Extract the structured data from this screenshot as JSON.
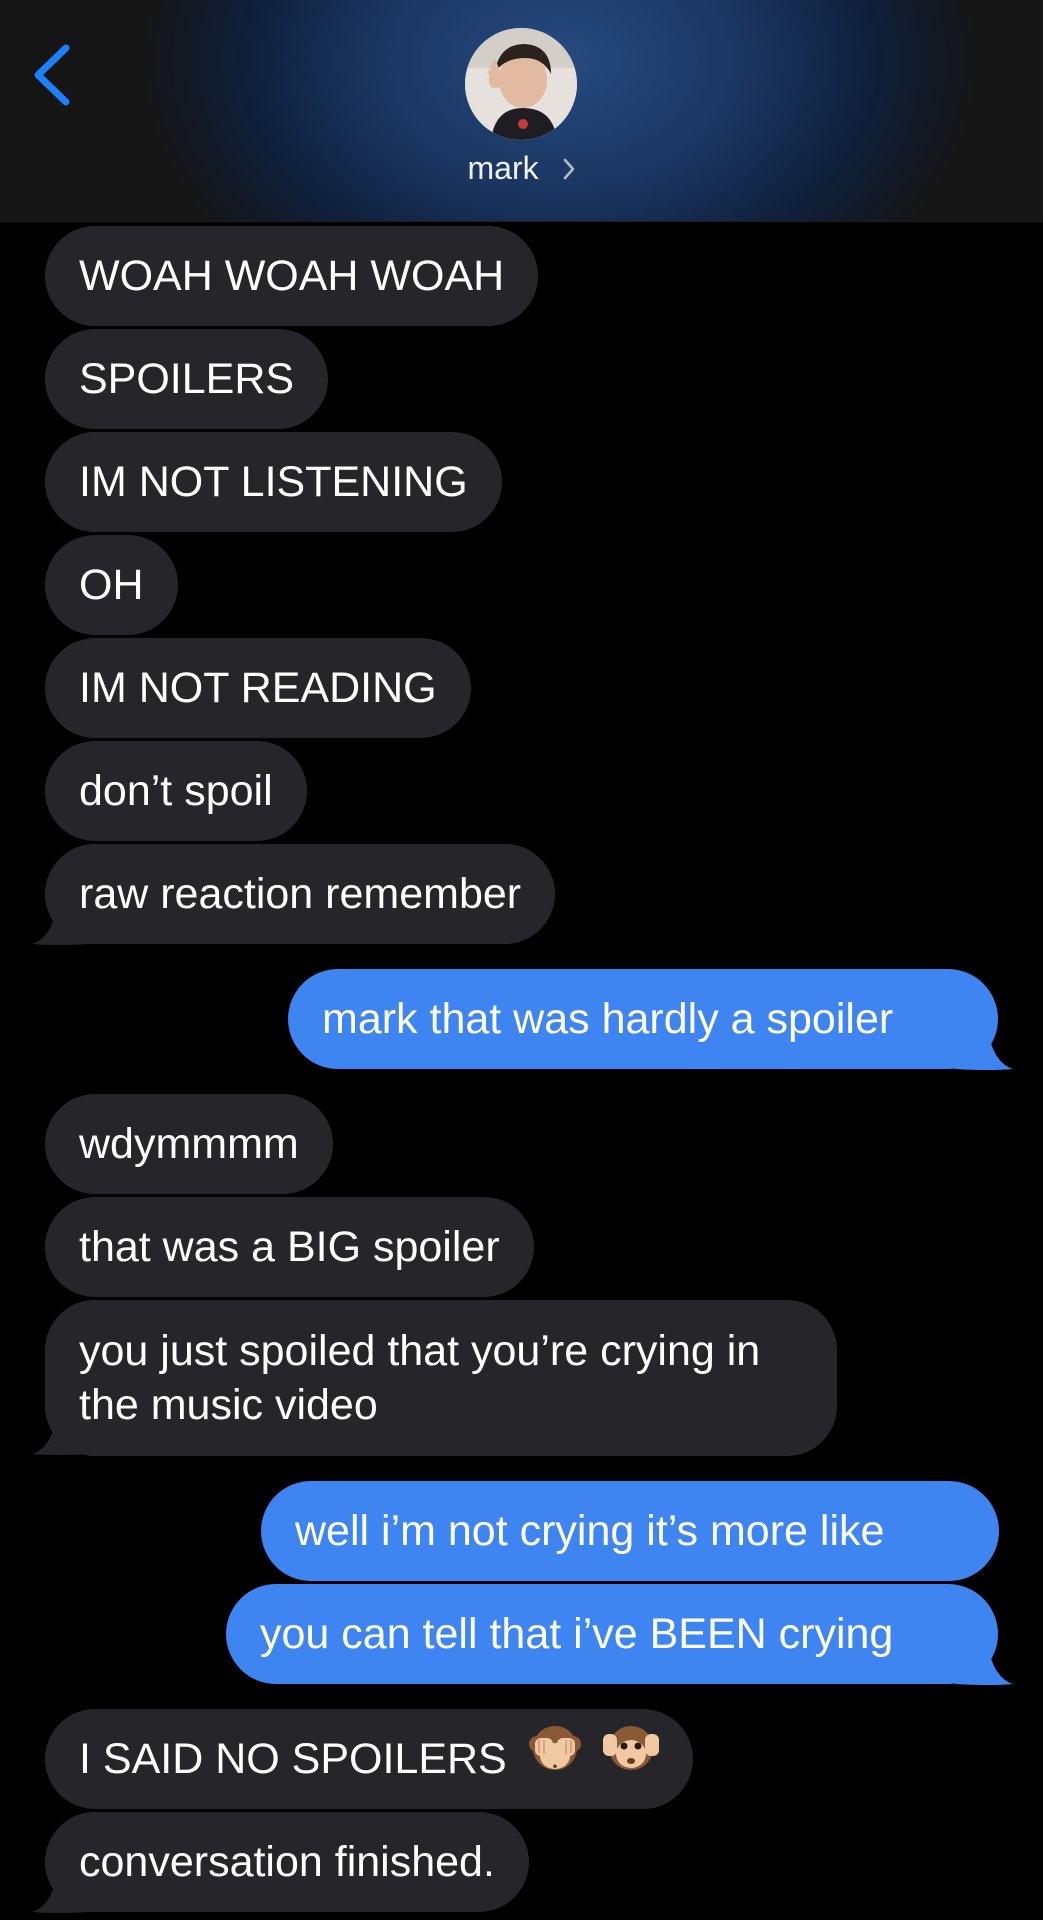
{
  "header": {
    "contact_name": "mark",
    "back_icon": "chevron-left-icon",
    "chevron_icon": "chevron-right-icon",
    "accent_color": "#1a82ff"
  },
  "colors": {
    "incoming_bubble": "#26262a",
    "outgoing_bubble": "#3e85f2",
    "background": "#000000"
  },
  "messages": [
    {
      "direction": "incoming",
      "text": "WOAH WOAH WOAH"
    },
    {
      "direction": "incoming",
      "text": "SPOILERS"
    },
    {
      "direction": "incoming",
      "text": "IM NOT LISTENING"
    },
    {
      "direction": "incoming",
      "text": "OH"
    },
    {
      "direction": "incoming",
      "text": "IM NOT READING"
    },
    {
      "direction": "incoming",
      "text": "don’t spoil"
    },
    {
      "direction": "incoming",
      "text": "raw reaction remember"
    },
    {
      "direction": "outgoing",
      "text": "mark that was hardly a spoiler"
    },
    {
      "direction": "incoming",
      "text": "wdymmmm"
    },
    {
      "direction": "incoming",
      "text": "that was a BIG spoiler"
    },
    {
      "direction": "incoming",
      "text": "you just spoiled that you’re crying in the music video"
    },
    {
      "direction": "outgoing",
      "text": "well i’m not crying it’s more like"
    },
    {
      "direction": "outgoing",
      "text": "you can tell that i’ve BEEN crying"
    },
    {
      "direction": "incoming",
      "text": "I SAID NO SPOILERS",
      "emojis": [
        "see-no-evil-monkey-icon",
        "hear-no-evil-monkey-icon"
      ]
    },
    {
      "direction": "incoming",
      "text": "conversation finished."
    }
  ]
}
